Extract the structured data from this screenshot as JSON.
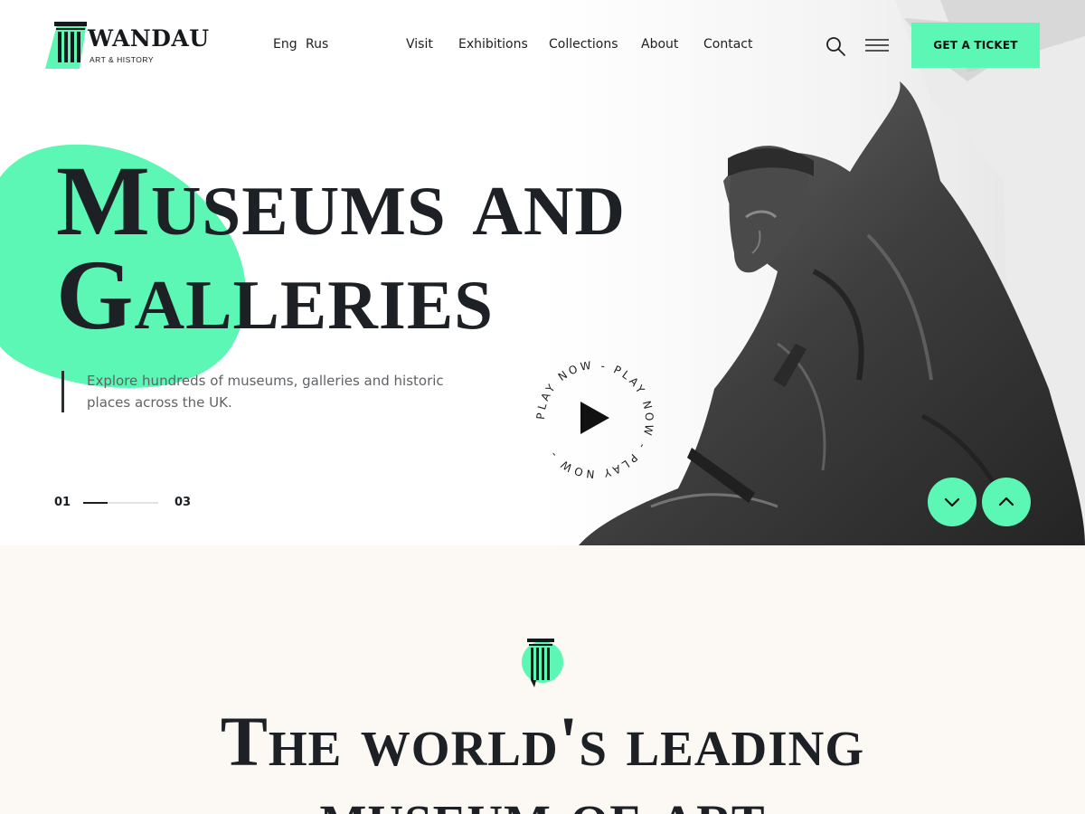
{
  "brand": {
    "name": "WANDAU",
    "tagline": "ART & HISTORY",
    "accent_color": "#5cf7b4"
  },
  "header": {
    "languages": [
      "Eng",
      "Rus"
    ],
    "nav": [
      "Visit",
      "Exhibitions",
      "Collections",
      "About",
      "Contact"
    ],
    "search_icon": "search-icon",
    "menu_icon": "hamburger-menu-icon",
    "cta_label": "GET A TICKET"
  },
  "hero": {
    "title_line1": "Museums and",
    "title_line2": "Galleries",
    "description": "Explore hundreds of museums, galleries and historic places across the UK.",
    "play_label": "PLAY NOW - PLAY NOW - PLAY NOW -",
    "slider": {
      "current": "01",
      "total": "03",
      "progress": 0.33
    },
    "arrow_down_icon": "chevron-down-icon",
    "arrow_up_icon": "chevron-up-icon"
  },
  "intro": {
    "title_line1": "The world's leading",
    "title_line2": "museum of art"
  }
}
